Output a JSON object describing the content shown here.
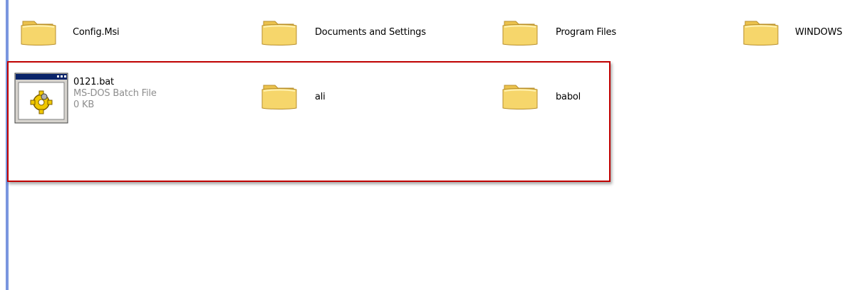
{
  "colors": {
    "highlight": "#c00000",
    "left_accent": "#7a96df",
    "secondary_text": "#8e8e8e",
    "folder_fill": "#f6d66b"
  },
  "items": {
    "config_msi": {
      "name": "Config.Msi",
      "icon": "folder-icon"
    },
    "documents_and_settings": {
      "name": "Documents and Settings",
      "icon": "folder-icon"
    },
    "program_files": {
      "name": "Program Files",
      "icon": "folder-icon"
    },
    "windows": {
      "name": "WINDOWS",
      "icon": "folder-icon"
    },
    "bat_file": {
      "name": "0121.bat",
      "type": "MS-DOS Batch File",
      "size": "0 KB",
      "icon": "batch-file-icon"
    },
    "ali": {
      "name": "ali",
      "icon": "folder-icon"
    },
    "babol": {
      "name": "babol",
      "icon": "folder-icon"
    }
  }
}
